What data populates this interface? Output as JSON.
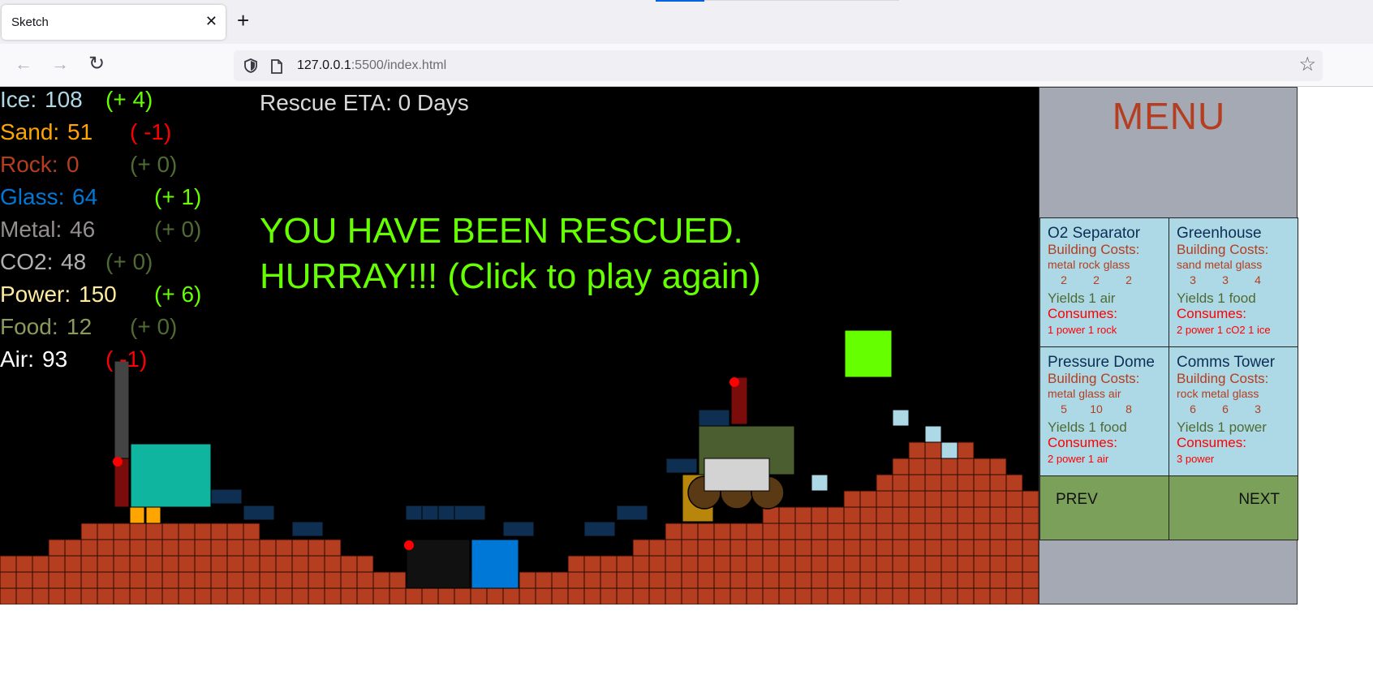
{
  "browser": {
    "tab_title": "Sketch",
    "tab_close": "✕",
    "new_tab": "+",
    "url_host": "127.0.0.1",
    "url_path": ":5500/index.html",
    "back_icon": "←",
    "forward_icon": "→",
    "reload_icon": "↻",
    "bookmark_icon": "☆"
  },
  "stats": [
    {
      "name": "Ice",
      "value": "108",
      "delta": "(+ 4)",
      "color": "#add8e6",
      "delta_color": "#66ff00"
    },
    {
      "name": "Sand",
      "value": "51",
      "delta": "( -1)",
      "color": "#ffa500",
      "delta_color": "#ff0000"
    },
    {
      "name": "Rock",
      "value": "0",
      "delta": "(+ 0)",
      "color": "#b43e1f",
      "delta_color": "#4f6b33"
    },
    {
      "name": "Glass",
      "value": "64",
      "delta": "(+ 1)",
      "color": "#0078d7",
      "delta_color": "#66ff00"
    },
    {
      "name": "Metal",
      "value": "46",
      "delta": "(+ 0)",
      "color": "#948e8e",
      "delta_color": "#4f6b33"
    },
    {
      "name": "CO2",
      "value": "48",
      "delta": "(+ 0)",
      "color": "#b0b0b0",
      "delta_color": "#4f6b33"
    },
    {
      "name": "Power",
      "value": "150",
      "delta": "(+ 6)",
      "color": "#ffeba0",
      "delta_color": "#66ff00"
    },
    {
      "name": "Food",
      "value": "12",
      "delta": "(+ 0)",
      "color": "#8a9a5b",
      "delta_color": "#4f6b33"
    },
    {
      "name": "Air",
      "value": "93",
      "delta": "( -1)",
      "color": "#ffffff",
      "delta_color": "#ff0000"
    }
  ],
  "hud": {
    "eta": "Rescue ETA: 0 Days",
    "message": "YOU HAVE BEEN RESCUED. HURRAY!!! (Click to play again)"
  },
  "menu": {
    "title": "MENU",
    "prev": "PREV",
    "next": "NEXT",
    "buildings": [
      {
        "name": "O2 Separator",
        "cost_label": "Building Costs:",
        "resources": [
          "metal",
          "rock",
          "glass"
        ],
        "amounts": [
          "2",
          "2",
          "2"
        ],
        "yields": "Yields 1 air",
        "consumes_label": "Consumes:",
        "consumes": "1 power  1 rock"
      },
      {
        "name": "Greenhouse",
        "cost_label": "Building Costs:",
        "resources": [
          "sand",
          "metal",
          "glass"
        ],
        "amounts": [
          "3",
          "3",
          "4"
        ],
        "yields": "Yields 1 food",
        "consumes_label": "Consumes:",
        "consumes": "2 power  1 cO2     1 ice"
      },
      {
        "name": "Pressure Dome",
        "cost_label": "Building Costs:",
        "resources": [
          "metal",
          "glass",
          "air"
        ],
        "amounts": [
          "5",
          "10",
          "8"
        ],
        "yields": "Yields 1 food",
        "consumes_label": "Consumes:",
        "consumes": "2 power  1 air"
      },
      {
        "name": "Comms Tower",
        "cost_label": "Building Costs:",
        "resources": [
          "rock",
          "metal",
          "glass"
        ],
        "amounts": [
          "6",
          "6",
          "3"
        ],
        "yields": "Yields 1 power",
        "consumes_label": "Consumes:",
        "consumes": "3 power"
      }
    ]
  },
  "colors": {
    "rock": "#b43e1f",
    "rock_outline": "#2a0a04",
    "ice": "#add8e6",
    "metal_block": "#0f2f52",
    "glass_block": "#0078d7",
    "sand_block": "#ffa500",
    "rescue_message": "#66ff00",
    "menu_bg": "#a5a9b4",
    "card_bg": "#add8e6",
    "nav_button": "#7aa05a"
  }
}
